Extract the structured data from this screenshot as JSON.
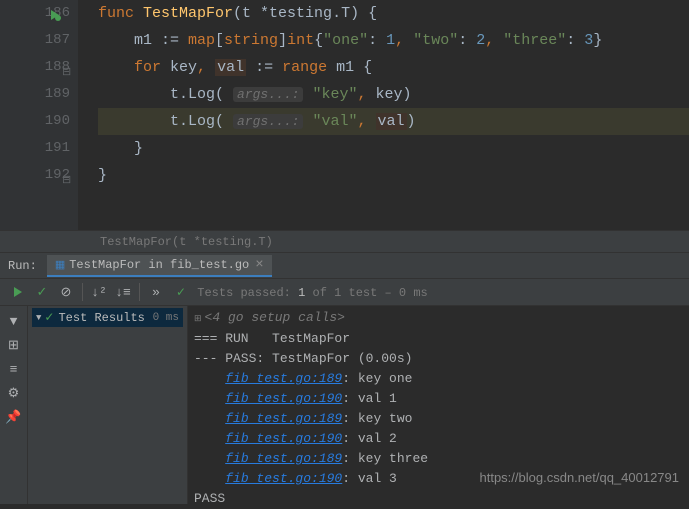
{
  "editor": {
    "lines": [
      {
        "num": "186",
        "code": "func TestMapFor(t *testing.T) {",
        "hasRun": true
      },
      {
        "num": "187",
        "code": "    m1 := map[string]int{\"one\": 1, \"two\": 2, \"three\": 3}"
      },
      {
        "num": "188",
        "code": "    for key, val := range m1 {",
        "hasFold": true
      },
      {
        "num": "189",
        "code": "        t.Log( args...: \"key\", key)"
      },
      {
        "num": "190",
        "code": "        t.Log( args...: \"val\", val)",
        "highlight": true
      },
      {
        "num": "191",
        "code": "    }"
      },
      {
        "num": "192",
        "code": "}",
        "hasFold": true
      }
    ]
  },
  "breadcrumb": "TestMapFor(t *testing.T)",
  "run": {
    "label": "Run:",
    "tab_label": "TestMapFor in fib_test.go"
  },
  "toolbar": {
    "status_prefix": "Tests passed:",
    "passed": "1",
    "of_text": "of 1 test",
    "duration": "0 ms"
  },
  "tree": {
    "root": "Test Results",
    "time": "0 ms"
  },
  "console": {
    "setup": "<4 go setup calls>",
    "lines": [
      "=== RUN   TestMapFor",
      "--- PASS: TestMapFor (0.00s)"
    ],
    "logs": [
      {
        "link": "fib_test.go:189",
        "text": ": key one"
      },
      {
        "link": "fib_test.go:190",
        "text": ": val 1"
      },
      {
        "link": "fib_test.go:189",
        "text": ": key two"
      },
      {
        "link": "fib_test.go:190",
        "text": ": val 2"
      },
      {
        "link": "fib_test.go:189",
        "text": ": key three"
      },
      {
        "link": "fib_test.go:190",
        "text": ": val 3"
      }
    ],
    "pass": "PASS"
  },
  "watermark": "https://blog.csdn.net/qq_40012791"
}
